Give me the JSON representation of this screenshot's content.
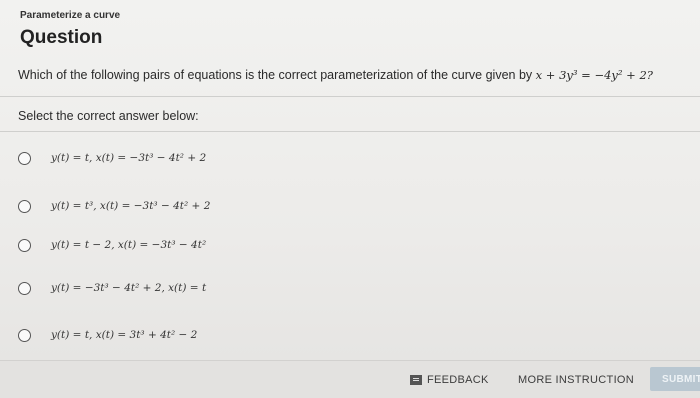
{
  "header": {
    "kicker": "Parameterize a curve",
    "title": "Question"
  },
  "question": {
    "text": "Which of the following pairs of equations is the correct parameterization of the curve given by",
    "equation": "x + 3y³ = −4y² + 2?"
  },
  "prompt": "Select the correct answer below:",
  "options": [
    {
      "label": "y(t) = t, x(t) = −3t³ − 4t² + 2"
    },
    {
      "label": "y(t) = t³, x(t) = −3t³ − 4t² + 2"
    },
    {
      "label": "y(t) = t − 2, x(t) = −3t³ − 4t²"
    },
    {
      "label": "y(t) = −3t³ − 4t² + 2, x(t) = t"
    },
    {
      "label": "y(t) = t, x(t) = 3t³ + 4t² − 2"
    }
  ],
  "footer": {
    "feedback": "FEEDBACK",
    "more_instruction": "MORE INSTRUCTION",
    "submit": "SUBMIT"
  },
  "icons": {
    "feedback": "flag-icon",
    "option": "radio-circle-icon"
  }
}
